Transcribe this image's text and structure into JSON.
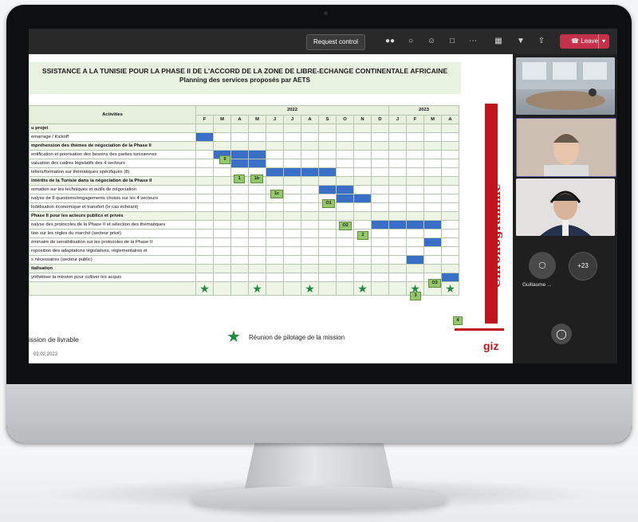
{
  "toolbar": {
    "request_control": "Request control",
    "leave": "Leave",
    "people_icon": "people-icon",
    "chat_icon": "chat-icon",
    "react_icon": "react-icon",
    "rooms_icon": "rooms-icon",
    "more_icon": "more-icon",
    "camera_icon": "camera-icon",
    "mic_icon": "mic-icon",
    "share_icon": "share-icon"
  },
  "slide": {
    "title_line1": "SSISTANCE A LA TUNISIE POUR LA PHASE II DE L'ACCORD DE LA ZONE DE LIBRE-ECHANGE CONTINENTALE AFRICAINE",
    "title_line2": "Planning des services proposés par AETS",
    "side_label": "Chronogramme",
    "legend_text": "Réunion de pilotage de la mission",
    "footer_left": "ission de livrable",
    "footer_date": "02.02.2022",
    "logo": "giz",
    "table": {
      "activities_header": "Activities",
      "year_2022": "2022",
      "year_2023": "2023",
      "months": [
        "F",
        "M",
        "A",
        "M",
        "J",
        "J",
        "A",
        "S",
        "O",
        "N",
        "D",
        "J",
        "F",
        "M",
        "A"
      ],
      "rows": [
        {
          "label": "u projet",
          "section": true
        },
        {
          "label": "emarrage / Kickoff",
          "section": false
        },
        {
          "label": "mpréhension des thèmes de négociation de la Phase II",
          "section": true
        },
        {
          "label": "entification et priorisation des besoins des parties tunisiennes",
          "section": false
        },
        {
          "label": "valuation des cadres législatifs des 4 secteurs",
          "section": false
        },
        {
          "label": "teliers/formation sur thématiques spécifiques (8)",
          "section": false
        },
        {
          "label": "intérêts de la Tunisie dans la négociation de la Phase II",
          "section": true
        },
        {
          "label": "ormation sur les techniques et outils de négociation",
          "section": false
        },
        {
          "label": "nalyse de 8 questions/engagements choisis sur les 4 secteurs",
          "section": false
        },
        {
          "label": "lodélisation économique et transfert (le cas échéant)",
          "section": false
        },
        {
          "label": "Phase II pour les acteurs publics et privés",
          "section": true
        },
        {
          "label": "nalyse des protocoles de la Phase II et sélection des thématiques",
          "section": false
        },
        {
          "label": "tion sur les règles du marché (secteur privé)",
          "section": false
        },
        {
          "label": "éminaire de sensibilisation sur les protocoles de la Phase II",
          "section": false
        },
        {
          "label": "roposition des adaptations législatives, réglementaires et",
          "section": false
        },
        {
          "label": "s nécessaires (secteur public)",
          "section": false
        },
        {
          "label": "italisation",
          "section": true
        },
        {
          "label": "ynthétiser la mission pour cultiver les acquis",
          "section": false
        }
      ],
      "milestones": [
        "0",
        "1",
        "1b",
        "1c",
        "O1",
        "O2",
        "2",
        "O3",
        "3",
        "4"
      ]
    }
  },
  "participants": {
    "overflow_count": "+23",
    "name": "Guillaume ..."
  }
}
